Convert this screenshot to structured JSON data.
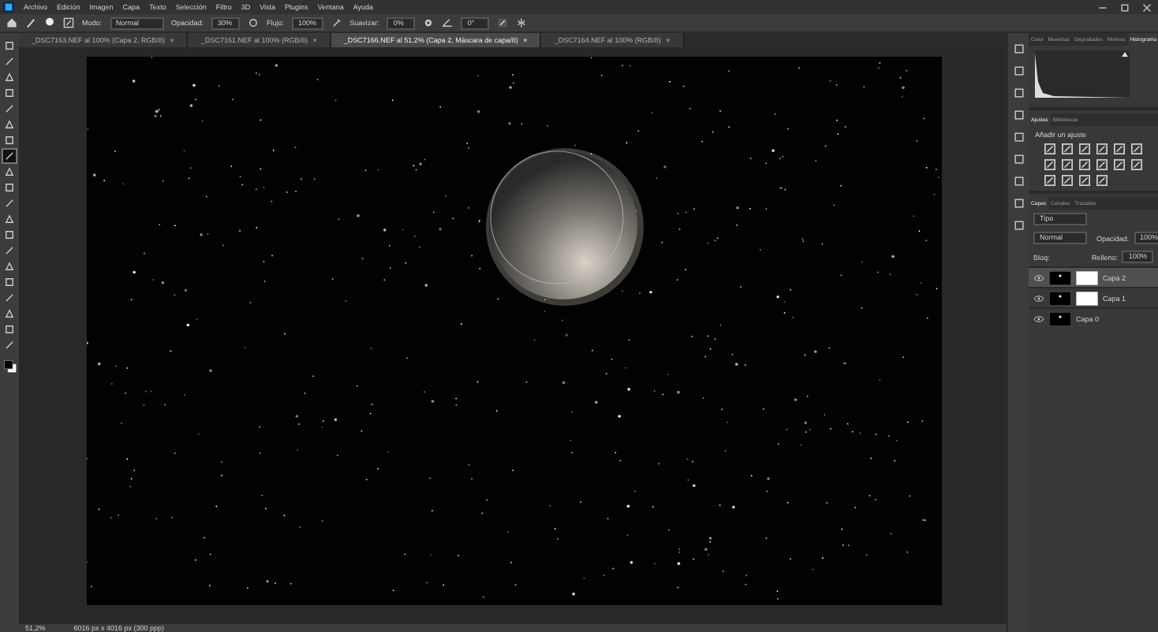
{
  "menu": [
    "Archivo",
    "Edición",
    "Imagen",
    "Capa",
    "Texto",
    "Selección",
    "Filtro",
    "3D",
    "Vista",
    "Plugins",
    "Ventana",
    "Ayuda"
  ],
  "options": {
    "mode_label": "Modo:",
    "mode": "Normal",
    "opacity_label": "Opacidad:",
    "opacity": "30%",
    "flow_label": "Flujo:",
    "flow": "100%",
    "smooth_label": "Suavizar:",
    "smooth": "0%",
    "angle": "0°"
  },
  "doc_tabs": [
    {
      "label": "_DSC7163.NEF al 100% (Capa 2, RGB/8)",
      "close": "×",
      "selected": false
    },
    {
      "label": "_DSC7161.NEF al 100% (RGB/8)",
      "close": "×",
      "selected": false
    },
    {
      "label": "_DSC7166.NEF al 51,2% (Capa 2, Máscara de capa/8)",
      "close": "×",
      "selected": true
    },
    {
      "label": "_DSC7164.NEF al 100% (RGB/8)",
      "close": "×",
      "selected": false
    }
  ],
  "tools": [
    {
      "selected": false
    },
    {
      "selected": false
    },
    {
      "selected": false
    },
    {
      "selected": false
    },
    {
      "selected": false
    },
    {
      "selected": false
    },
    {
      "selected": false
    },
    {
      "selected": true
    },
    {
      "selected": false
    },
    {
      "selected": false
    },
    {
      "selected": false
    },
    {
      "selected": false
    },
    {
      "selected": false
    },
    {
      "selected": false
    },
    {
      "selected": false
    },
    {
      "selected": false
    },
    {
      "selected": false
    },
    {
      "selected": false
    },
    {
      "selected": false
    },
    {
      "selected": false
    }
  ],
  "histogram_tabs": [
    {
      "label": "Color",
      "selected": false
    },
    {
      "label": "Muestras",
      "selected": false
    },
    {
      "label": "Degradados",
      "selected": false
    },
    {
      "label": "Motivos",
      "selected": false
    },
    {
      "label": "Histograma",
      "selected": true
    }
  ],
  "adjust_tabs": [
    {
      "label": "Ajustes",
      "selected": true
    },
    {
      "label": "Bibliotecas",
      "selected": false
    }
  ],
  "adjust_hint": "Añadir un ajuste",
  "layers_tabs": [
    {
      "label": "Capas",
      "selected": true
    },
    {
      "label": "Canales",
      "selected": false
    },
    {
      "label": "Trazados",
      "selected": false
    }
  ],
  "layers": {
    "filter": "Tipo",
    "blend": "Normal",
    "opacity_label": "Opacidad:",
    "opacity": "100%",
    "lock_label": "Bloq:",
    "fill_label": "Relleno:",
    "fill": "100%",
    "items": [
      {
        "name": "Capa 2",
        "mask": true,
        "selected": true,
        "visible": true
      },
      {
        "name": "Capa 1",
        "mask": true,
        "selected": false,
        "visible": true
      },
      {
        "name": "Capa 0",
        "mask": false,
        "selected": false,
        "visible": true
      }
    ]
  },
  "status": {
    "zoom": "51,2%",
    "info": "6016 px x 4016 px (300 ppp)"
  }
}
